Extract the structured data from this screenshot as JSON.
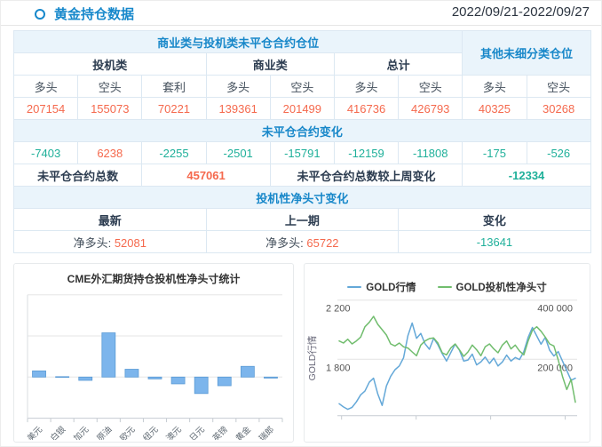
{
  "header": {
    "title": "黄金持仓数据",
    "date_range": "2022/09/21-2022/09/27"
  },
  "colors": {
    "accent_blue": "#1788cb",
    "header_bg": "#eaf4fb",
    "positive_orange": "#f5694d",
    "negative_teal": "#1fb09a",
    "bar_fill": "#7cb5ec",
    "bar_border": "#5b9bd5",
    "gold_price_line": "#64a8d8",
    "net_position_line": "#71bd6e"
  },
  "table": {
    "rows": [
      [
        {
          "t": "商业类与投机类未平仓合约仓位",
          "colspan": 7,
          "cls": "hblue",
          "name": "table-header-commercial-speculative"
        },
        {
          "t": "其他未细分类仓位",
          "colspan": 2,
          "rowspan": 2,
          "cls": "hblue",
          "name": "table-header-other-unclassified"
        }
      ],
      [
        {
          "t": "投机类",
          "colspan": 3,
          "cls": "sub"
        },
        {
          "t": "商业类",
          "colspan": 2,
          "cls": "sub"
        },
        {
          "t": "总计",
          "colspan": 2,
          "cls": "sub"
        }
      ],
      [
        {
          "t": "多头"
        },
        {
          "t": "空头"
        },
        {
          "t": "套利"
        },
        {
          "t": "多头"
        },
        {
          "t": "空头"
        },
        {
          "t": "多头"
        },
        {
          "t": "空头"
        },
        {
          "t": "多头"
        },
        {
          "t": "空头"
        }
      ],
      [
        {
          "t": "207154",
          "cls": "orange"
        },
        {
          "t": "155073",
          "cls": "orange"
        },
        {
          "t": "70221",
          "cls": "orange"
        },
        {
          "t": "139361",
          "cls": "orange"
        },
        {
          "t": "201499",
          "cls": "orange"
        },
        {
          "t": "416736",
          "cls": "orange"
        },
        {
          "t": "426793",
          "cls": "orange"
        },
        {
          "t": "40325",
          "cls": "orange"
        },
        {
          "t": "30268",
          "cls": "orange"
        }
      ],
      [
        {
          "t": "未平仓合约变化",
          "colspan": 9,
          "cls": "hblue",
          "name": "table-header-open-interest-change"
        }
      ],
      [
        {
          "t": "-7403",
          "cls": "teal"
        },
        {
          "t": "6238",
          "cls": "orange"
        },
        {
          "t": "-2255",
          "cls": "teal"
        },
        {
          "t": "-2501",
          "cls": "teal"
        },
        {
          "t": "-15791",
          "cls": "teal"
        },
        {
          "t": "-12159",
          "cls": "teal"
        },
        {
          "t": "-11808",
          "cls": "teal"
        },
        {
          "t": "-175",
          "cls": "teal"
        },
        {
          "t": "-526",
          "cls": "teal"
        }
      ],
      [
        {
          "t": "未平仓合约总数",
          "colspan": 2,
          "cls": "strong"
        },
        {
          "t": "457061",
          "colspan": 2,
          "cls": "orange vb"
        },
        {
          "t": "未平仓合约总数较上周变化",
          "colspan": 3,
          "cls": "strong"
        },
        {
          "t": "-12334",
          "colspan": 2,
          "cls": "teal vb"
        }
      ],
      [
        {
          "t": "投机性净头寸变化",
          "colspan": 9,
          "cls": "hblue",
          "name": "table-header-speculative-net-change"
        }
      ],
      [
        {
          "t": "最新",
          "colspan": 3,
          "cls": "strong"
        },
        {
          "t": "上一期",
          "colspan": 3,
          "cls": "strong"
        },
        {
          "t": "变化",
          "colspan": 3,
          "cls": "strong"
        }
      ],
      [
        {
          "parts": [
            {
              "t": "净多头: "
            },
            {
              "t": "52081",
              "cls": "orange"
            }
          ],
          "colspan": 3,
          "name": "latest-net-long-cell"
        },
        {
          "parts": [
            {
              "t": "净多头: "
            },
            {
              "t": "65722",
              "cls": "orange"
            }
          ],
          "colspan": 3,
          "name": "previous-net-long-cell"
        },
        {
          "t": "-13641",
          "colspan": 3,
          "cls": "teal",
          "name": "net-long-change-cell"
        }
      ]
    ]
  },
  "chart_data": [
    {
      "type": "bar",
      "title": "CME外汇期货持仓投机性净头寸统计",
      "categories": [
        "美元",
        "白银",
        "加元",
        "原油",
        "欧元",
        "纽元",
        "澳元",
        "日元",
        "英镑",
        "黄金",
        "瑞郎"
      ],
      "values": [
        30000,
        2000,
        -16000,
        215000,
        38000,
        -9000,
        -33000,
        -80000,
        -42000,
        52081,
        -5000
      ],
      "ylim": [
        -200000,
        400000
      ],
      "grid_step": 200000,
      "xlabel": "",
      "ylabel": "",
      "legend_position": "none"
    },
    {
      "type": "line",
      "title": "",
      "ylabel_left": "GOLD行情",
      "legend": [
        {
          "label": "GOLD行情",
          "color": "#64a8d8"
        },
        {
          "label": "GOLD投机性净头寸",
          "color": "#71bd6e"
        }
      ],
      "left_axis": {
        "range": [
          1419,
          2252
        ],
        "ticks": [
          {
            "label": "2 200",
            "value": 2200
          },
          {
            "label": "1 800",
            "value": 1800
          }
        ]
      },
      "right_axis": {
        "range": [
          9600,
          426000
        ],
        "ticks": [
          {
            "label": "400 000",
            "value": 400000
          },
          {
            "label": "200 000",
            "value": 200000
          }
        ]
      },
      "series": [
        {
          "name": "GOLD行情",
          "axis": "left",
          "color": "#64a8d8",
          "values": [
            1500,
            1478,
            1462,
            1475,
            1512,
            1560,
            1585,
            1645,
            1672,
            1565,
            1488,
            1620,
            1685,
            1730,
            1755,
            1810,
            1960,
            2045,
            1942,
            1975,
            1905,
            1868,
            1942,
            1898,
            1838,
            1788,
            1845,
            1902,
            1862,
            1788,
            1795,
            1835,
            1762,
            1782,
            1815,
            1772,
            1808,
            1755,
            1782,
            1828,
            1788,
            1812,
            1798,
            1852,
            1948,
            2015,
            1958,
            1902,
            1948,
            1862,
            1822,
            1852,
            1788,
            1725,
            1658,
            1672
          ]
        },
        {
          "name": "GOLD投机性净头寸",
          "axis": "right",
          "color": "#71bd6e",
          "values": [
            262000,
            255000,
            268000,
            252000,
            262000,
            275000,
            310000,
            325000,
            345000,
            318000,
            300000,
            282000,
            252000,
            245000,
            255000,
            242000,
            238000,
            225000,
            212000,
            248000,
            262000,
            270000,
            272000,
            255000,
            222000,
            215000,
            238000,
            252000,
            232000,
            210000,
            225000,
            248000,
            232000,
            212000,
            242000,
            252000,
            235000,
            222000,
            248000,
            262000,
            235000,
            248000,
            228000,
            215000,
            262000,
            298000,
            310000,
            295000,
            275000,
            252000,
            245000,
            198000,
            142000,
            98000,
            132000,
            55000
          ]
        }
      ]
    }
  ]
}
